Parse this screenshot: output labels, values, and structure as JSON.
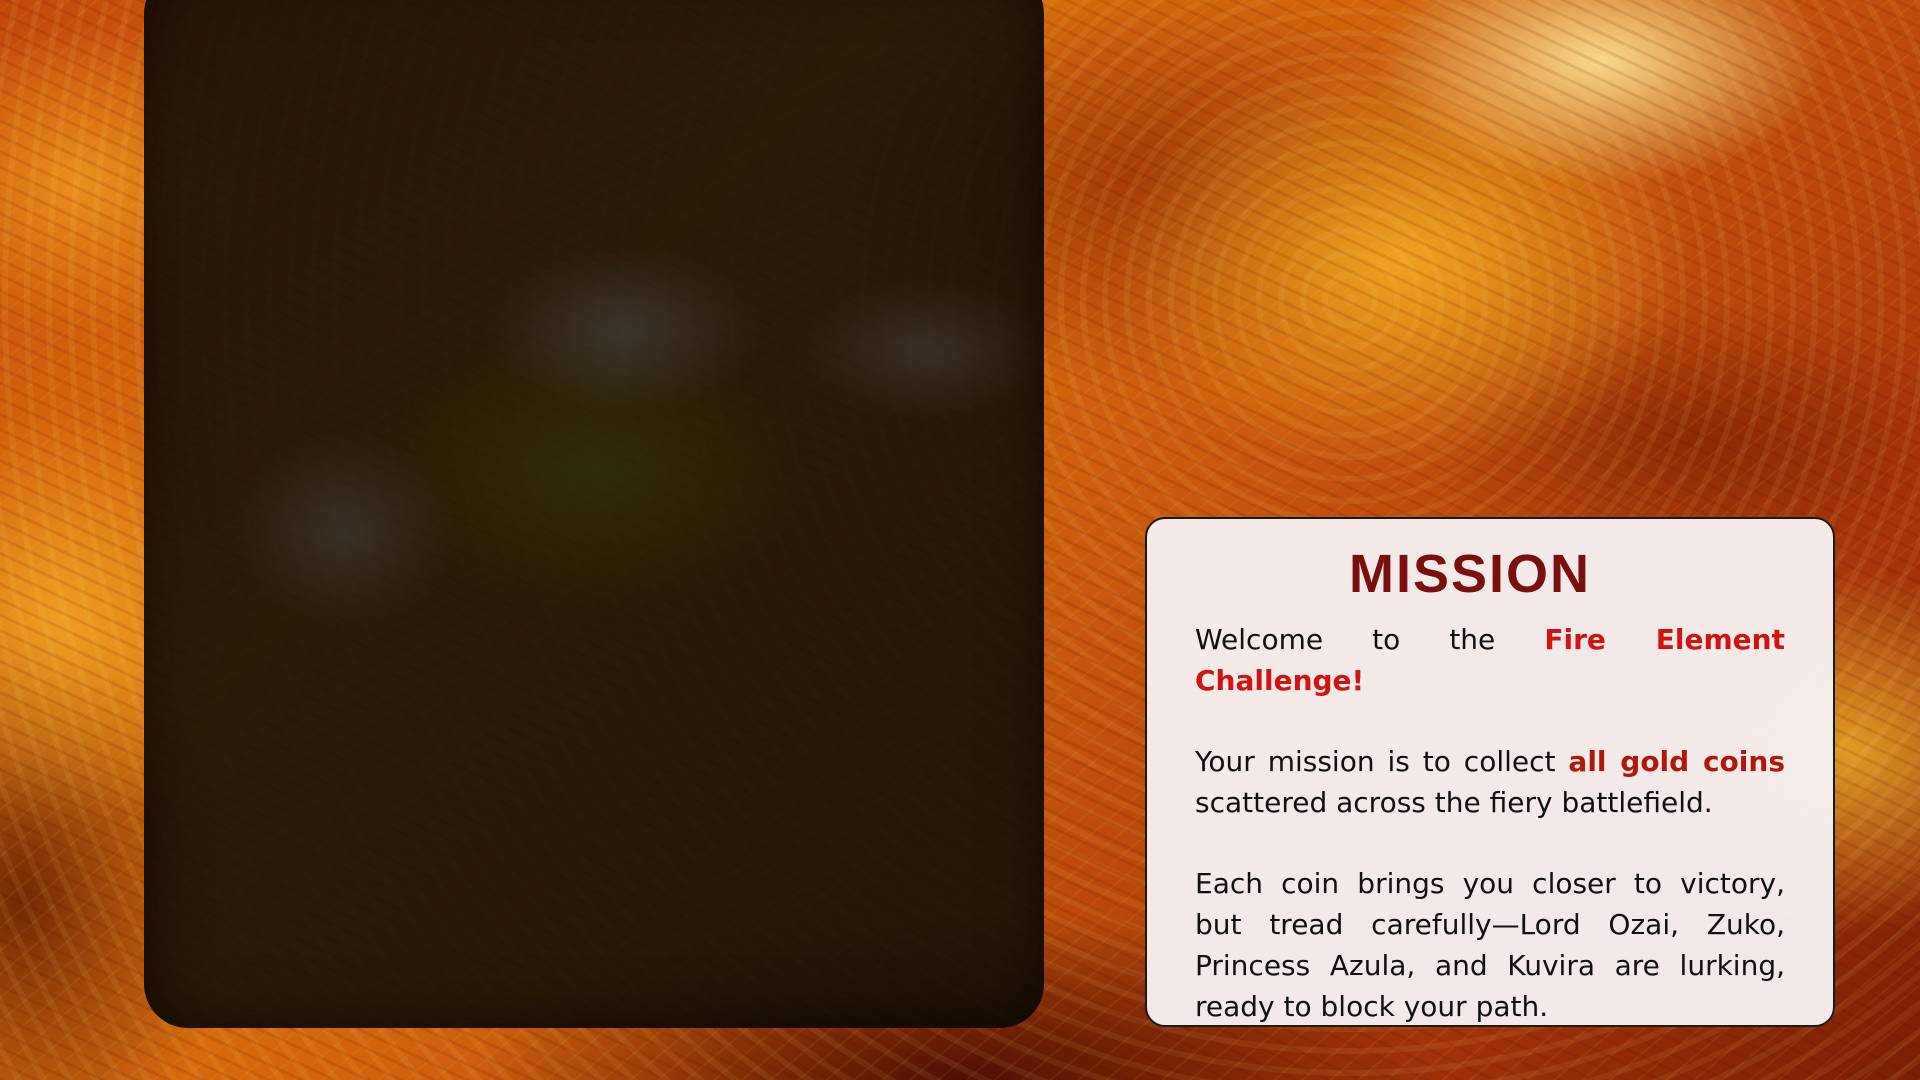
{
  "mission": {
    "title": "MISSION",
    "intro_prefix": "Welcome to the ",
    "intro_highlight": "Fire Element Challenge!",
    "goal_prefix": "Your mission is to collect ",
    "goal_highlight": "all gold coins",
    "goal_suffix": " scattered across the fiery battlefield.",
    "warning": "Each coin brings you closer to victory, but tread carefully—Lord Ozai, Zuko, Princess Azula, and Kuvira are lurking, ready to block your path."
  },
  "colors": {
    "title": "#7a0f0f",
    "highlight_primary": "#d01414",
    "highlight_secondary": "#b0180c",
    "card_background": "#f6f0f1",
    "panel_background": "#120e04"
  }
}
